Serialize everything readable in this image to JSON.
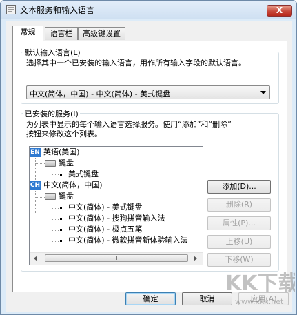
{
  "window": {
    "title": "文本服务和输入语言",
    "close_glyph": "X"
  },
  "tabs": [
    {
      "label": "常规"
    },
    {
      "label": "语言栏"
    },
    {
      "label": "高级键设置"
    }
  ],
  "default_language": {
    "legend": "默认输入语言(L)",
    "description": "选择其中一个已安装的输入语言，用作所有输入字段的默认语言。",
    "selected": "中文(简体，中国) - 中文(简体) - 美式键盘"
  },
  "installed_services": {
    "legend": "已安装的服务(I)",
    "description_line1": "为列表中显示的每个输入语言选择服务。使用“添加”和“删除”",
    "description_line2": "按钮来修改这个列表。",
    "tree": {
      "lang1": {
        "icon_label": "EN",
        "label": "英语(美国)"
      },
      "lang1_kbd": "键盘",
      "lang1_item": "美式键盘",
      "lang2": {
        "icon_label": "CH",
        "label": "中文(简体，中国)"
      },
      "lang2_kbd": "键盘",
      "lang2_items": [
        "中文(简体) - 美式键盘",
        "中文(简体) - 搜狗拼音输入法",
        "中文(简体) - 极点五笔",
        "中文(简体) - 微软拼音新体验输入法"
      ]
    },
    "buttons": {
      "add": "添加(D)...",
      "remove": "删除(R)",
      "properties": "属性(P)...",
      "move_up": "上移(U)",
      "move_down": "下移(W)"
    }
  },
  "footer": {
    "ok": "确定",
    "cancel": "取消",
    "apply": "应用(A)"
  },
  "watermark": {
    "text": "KK下载",
    "url": "www.kkx.net"
  },
  "colors": {
    "title_bg": "#dcebf8",
    "close_red": "#c7483a",
    "language_icon_blue": "#2f7ad1"
  }
}
